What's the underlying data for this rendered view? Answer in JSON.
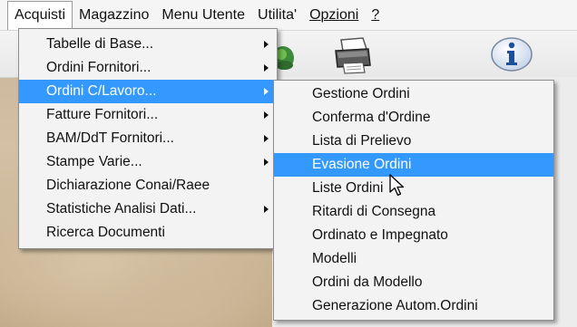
{
  "menubar": {
    "items": [
      {
        "label": "Acquisti"
      },
      {
        "label": "Magazzino"
      },
      {
        "label": "Menu Utente"
      },
      {
        "label": "Utilita'"
      },
      {
        "label": "Opzioni"
      },
      {
        "label": "?"
      }
    ]
  },
  "toolbar": {
    "icons": [
      "frog-icon",
      "printer-icon",
      "info-icon"
    ]
  },
  "menu_acquisti": {
    "items": [
      {
        "label": "Tabelle di Base...",
        "has_submenu": true
      },
      {
        "label": "Ordini Fornitori...",
        "has_submenu": true
      },
      {
        "label": "Ordini C/Lavoro...",
        "has_submenu": true,
        "highlighted": true
      },
      {
        "label": "Fatture Fornitori...",
        "has_submenu": true
      },
      {
        "label": "BAM/DdT Fornitori...",
        "has_submenu": true
      },
      {
        "label": "Stampe Varie...",
        "has_submenu": true
      },
      {
        "label": "Dichiarazione Conai/Raee",
        "has_submenu": false
      },
      {
        "label": "Statistiche Analisi Dati...",
        "has_submenu": true
      },
      {
        "label": "Ricerca Documenti",
        "has_submenu": false
      }
    ]
  },
  "submenu_ordini_clavoro": {
    "items": [
      {
        "label": "Gestione Ordini"
      },
      {
        "label": "Conferma d'Ordine"
      },
      {
        "label": "Lista di Prelievo"
      },
      {
        "label": "Evasione Ordini",
        "highlighted": true
      },
      {
        "label": "Liste Ordini"
      },
      {
        "label": "Ritardi di Consegna"
      },
      {
        "label": "Ordinato e Impegnato"
      },
      {
        "label": "Modelli"
      },
      {
        "label": "Ordini da Modello"
      },
      {
        "label": "Generazione Autom.Ordini"
      }
    ]
  },
  "colors": {
    "highlight": "#3399ff",
    "menu_bg": "#f3f3f3"
  }
}
